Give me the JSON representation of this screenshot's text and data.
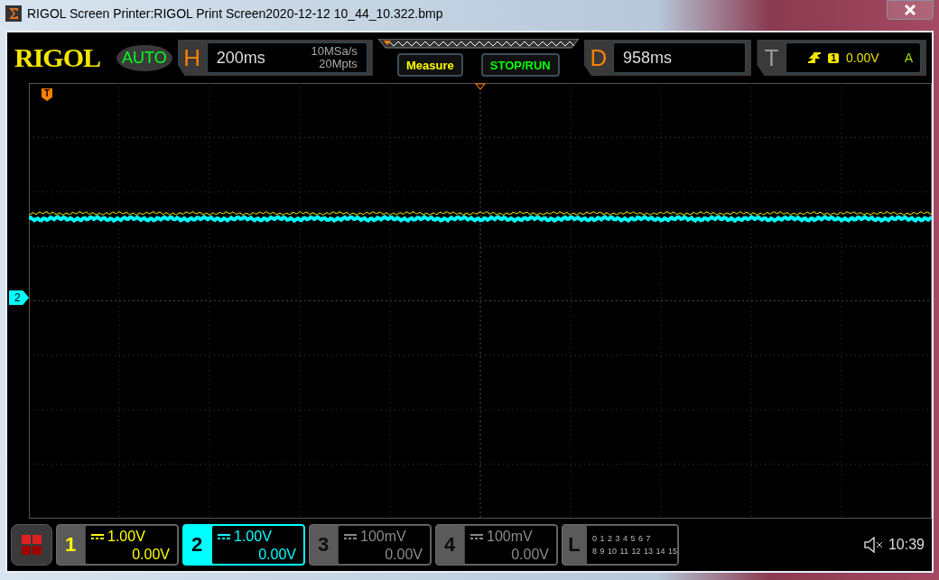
{
  "window": {
    "title": "RIGOL Screen Printer:RIGOL Print Screen2020-12-12 10_44_10.322.bmp"
  },
  "top_bar": {
    "logo": "RIGOL",
    "mode": "AUTO",
    "horizontal": {
      "label": "H",
      "timebase": "200ms",
      "sample_rate": "10MSa/s",
      "memory_depth": "20Mpts"
    },
    "buttons": [
      {
        "label": "Measure",
        "color": "#ffff00"
      },
      {
        "label": "STOP/RUN",
        "color": "#00ff00"
      }
    ],
    "delay": {
      "label": "D",
      "value": "958ms"
    },
    "trigger": {
      "label": "T",
      "source": "1",
      "level": "0.00V",
      "mode": "A"
    }
  },
  "grid": {
    "trigger_marker": "T",
    "channel_marker": "2"
  },
  "channels": [
    {
      "number": "1",
      "scale": "1.00V",
      "offset": "0.00V",
      "on": true,
      "selected": false,
      "color": "#ffff00"
    },
    {
      "number": "2",
      "scale": "1.00V",
      "offset": "0.00V",
      "on": true,
      "selected": true,
      "color": "#00ffff"
    },
    {
      "number": "3",
      "scale": "100mV",
      "offset": "0.00V",
      "on": false,
      "selected": false
    },
    {
      "number": "4",
      "scale": "100mV",
      "offset": "0.00V",
      "on": false,
      "selected": false
    }
  ],
  "logic": {
    "label": "L",
    "row_1": [
      "0",
      "1",
      "2",
      "3",
      "4",
      "5",
      "6",
      "7"
    ],
    "row_2": [
      "8",
      "9",
      "10",
      "11",
      "12",
      "13",
      "14",
      "15"
    ]
  },
  "status": {
    "muted": true,
    "time": "10:39"
  }
}
